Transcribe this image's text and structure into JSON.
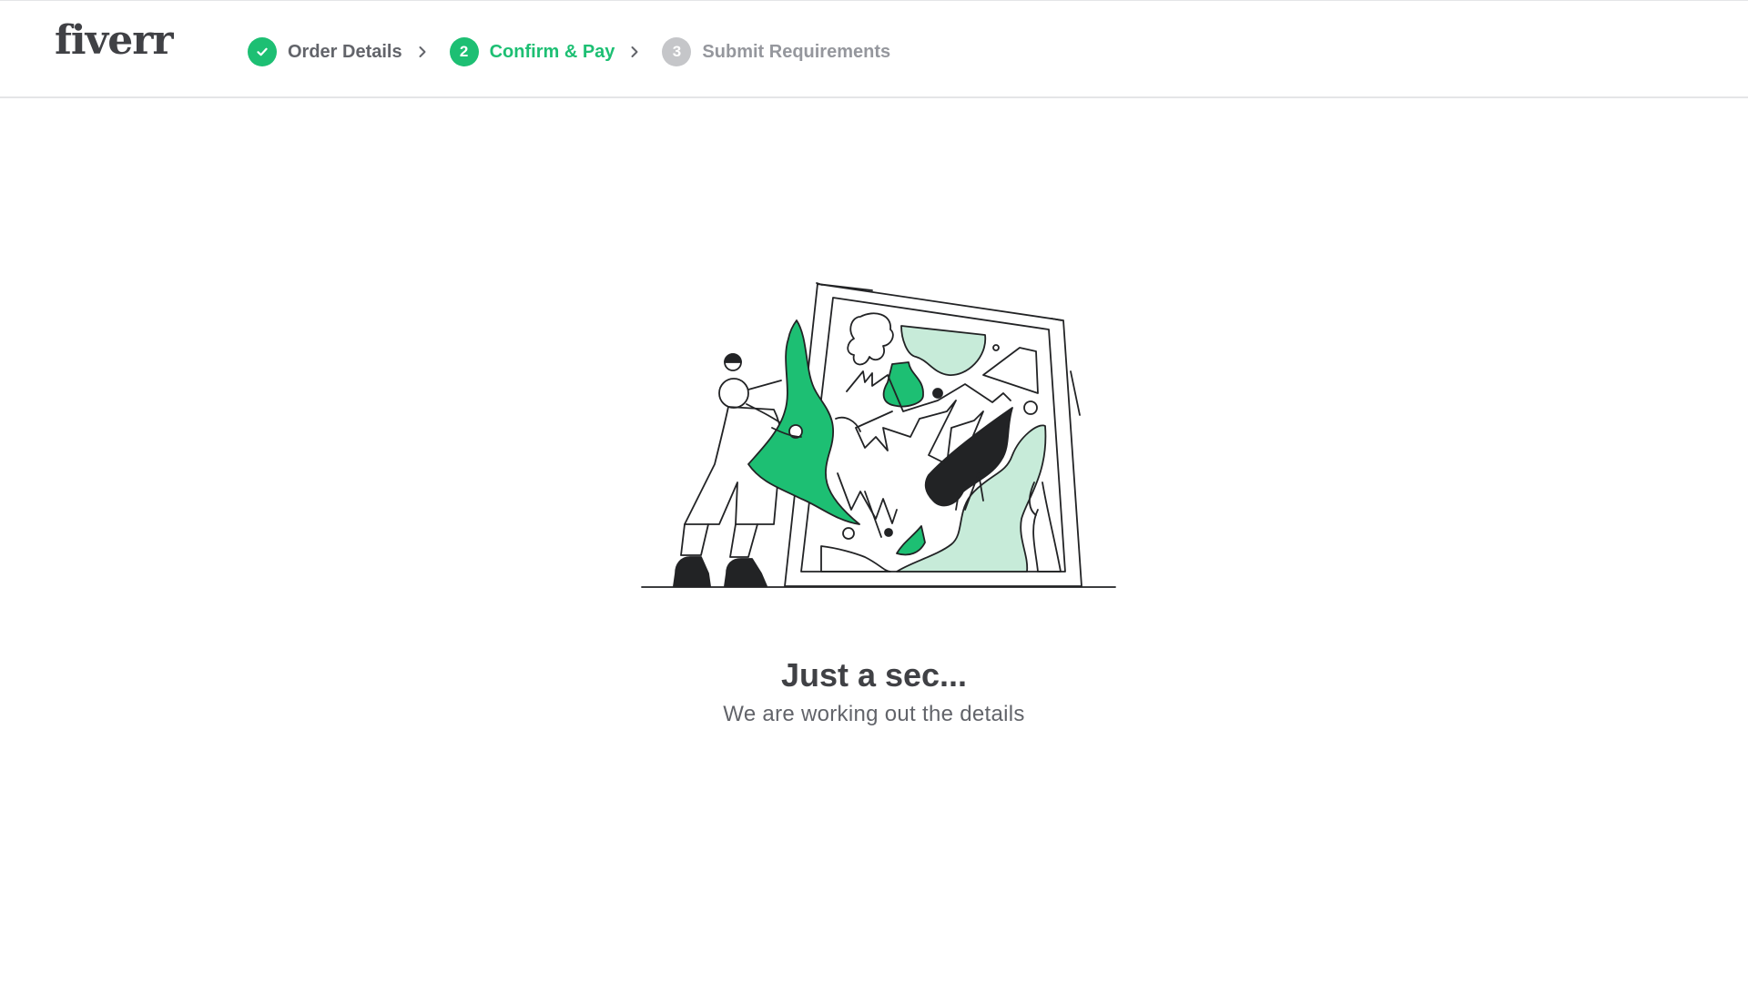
{
  "brand": {
    "logo_text": "fiverr",
    "accent_color": "#1dbf73",
    "mint_color": "#c7ebd9",
    "text_dark": "#404145"
  },
  "steps": [
    {
      "number": "",
      "label": "Order Details",
      "state": "done",
      "icon": "check-icon"
    },
    {
      "number": "2",
      "label": "Confirm & Pay",
      "state": "active"
    },
    {
      "number": "3",
      "label": "Submit Requirements",
      "state": "pending"
    }
  ],
  "loading": {
    "title": "Just a sec...",
    "subtitle": "We are working out the details"
  }
}
